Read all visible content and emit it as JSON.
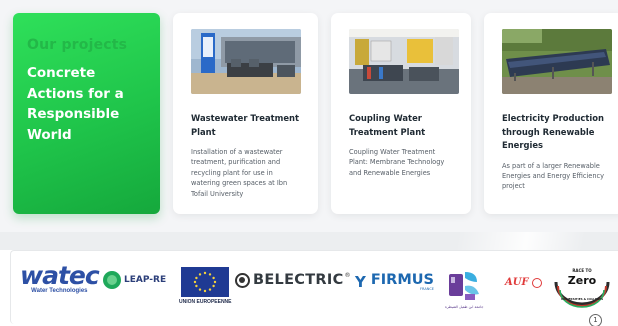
{
  "hero": {
    "kicker": "Our projects",
    "title_lines": [
      "Concrete",
      "Actions for a",
      "Responsible",
      "World"
    ]
  },
  "projects": [
    {
      "title": "Wastewater Treatment Plant",
      "description": "Installation of a wastewater treatment, purification and recycling plant for use in watering green spaces at Ibn Tofail University",
      "thumb_icon": "treatment-plant-photo"
    },
    {
      "title": "Coupling Water Treatment Plant",
      "description": "Coupling Water Treatment Plant: Membrane Technology and Renewable Energies",
      "thumb_icon": "membrane-equipment-photo"
    },
    {
      "title": "Electricity Production through Renewable Energies",
      "description": "As part of a larger Renewable Energies and Energy Efficiency project",
      "thumb_icon": "solar-panels-photo"
    }
  ],
  "partners": {
    "watec": "watec",
    "watec_sub": "Water Technologies",
    "leap": "LEAP-RE",
    "eu": "UNION EUROPEENNE",
    "belectric": "BELECTRIC",
    "belectric_mark": "®",
    "firmus": "FIRMUS",
    "firmus_sub": "FRANCE",
    "uni_caption": "جامعة ابن طفيل القنيطرة",
    "auf": "AUF",
    "rtz_top": "RACE TO",
    "rtz_main": "Zero",
    "rtz_bottom": "UNIVERSITIES & COLLEGES"
  },
  "page": {
    "number": "1"
  },
  "colors": {
    "hero_green": "#1fc44a",
    "title_dark": "#1f2a33",
    "text_gray": "#555d66",
    "watec_blue": "#2d50a5",
    "firmus_blue": "#1d68b0",
    "auf_red": "#e03a3a"
  }
}
